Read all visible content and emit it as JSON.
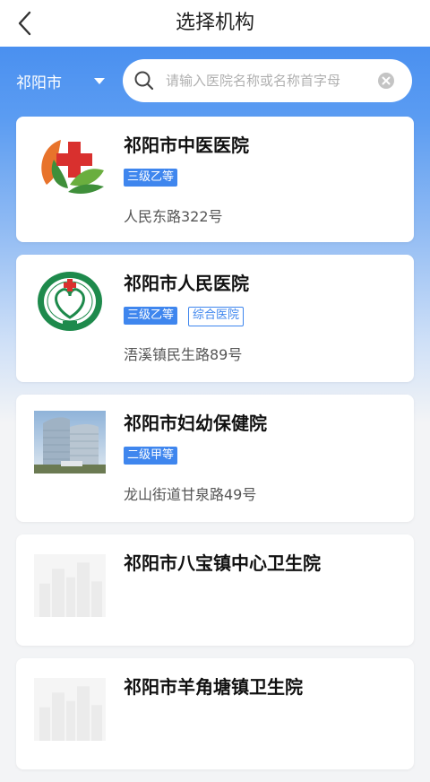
{
  "header": {
    "title": "选择机构"
  },
  "filter": {
    "city": "祁阳市",
    "search_placeholder": "请输入医院名称或名称首字母"
  },
  "colors": {
    "accent": "#3f86ee",
    "band_top": "#4a90f0"
  },
  "hospitals": [
    {
      "name": "祁阳市中医医院",
      "tags": [
        "三级乙等"
      ],
      "address": "人民东路322号",
      "thumb": "tcm-hospital-logo"
    },
    {
      "name": "祁阳市人民医院",
      "tags": [
        "三级乙等",
        "综合医院"
      ],
      "address": "浯溪镇民生路89号",
      "thumb": "peoples-hospital-logo"
    },
    {
      "name": "祁阳市妇幼保健院",
      "tags": [
        "二级甲等"
      ],
      "address": "龙山街道甘泉路49号",
      "thumb": "building-photo"
    },
    {
      "name": "祁阳市八宝镇中心卫生院",
      "tags": [],
      "address": "",
      "thumb": "placeholder-image"
    },
    {
      "name": "祁阳市羊角塘镇卫生院",
      "tags": [],
      "address": "",
      "thumb": "placeholder-image"
    }
  ]
}
